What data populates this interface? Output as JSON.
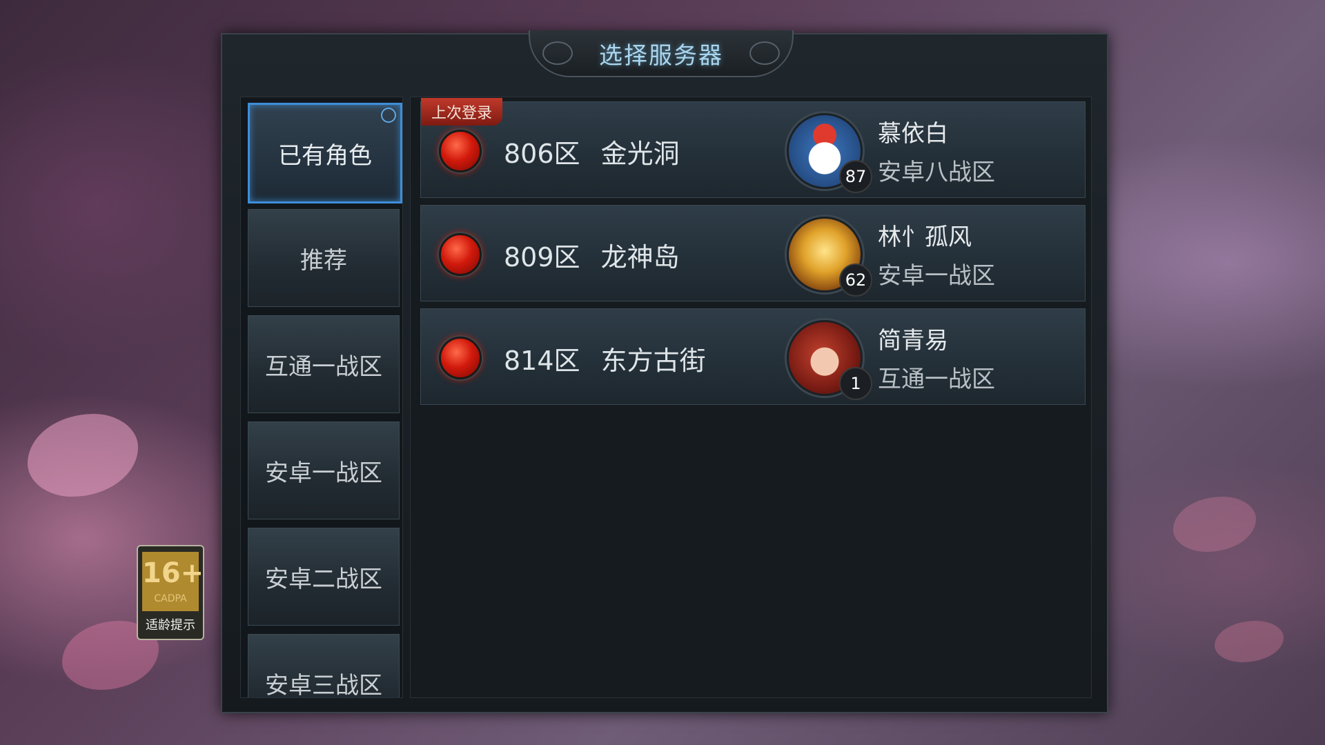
{
  "title": "选择服务器",
  "sidebar": {
    "tabs": [
      {
        "label": "已有角色",
        "active": true
      },
      {
        "label": "推荐"
      },
      {
        "label": "互通一战区"
      },
      {
        "label": "安卓一战区"
      },
      {
        "label": "安卓二战区"
      },
      {
        "label": "安卓三战区"
      }
    ]
  },
  "servers": [
    {
      "tag": "上次登录",
      "number": "806区",
      "name": "金光洞",
      "character": "慕依白",
      "zone": "安卓八战区",
      "level": "87",
      "status_color": "#d21a0c"
    },
    {
      "number": "809区",
      "name": "龙神岛",
      "character": "林忄孤风",
      "zone": "安卓一战区",
      "level": "62",
      "status_color": "#d21a0c"
    },
    {
      "number": "814区",
      "name": "东方古街",
      "character": "简青易",
      "zone": "互通一战区",
      "level": "1",
      "status_color": "#d21a0c"
    }
  ],
  "age_rating": {
    "number": "16+",
    "org": "CADPA",
    "label": "适龄提示"
  },
  "icons": [
    "snowman-avatar-icon",
    "golden-warrior-avatar-icon",
    "female-warrior-avatar-icon",
    "red-status-dot-icon"
  ]
}
